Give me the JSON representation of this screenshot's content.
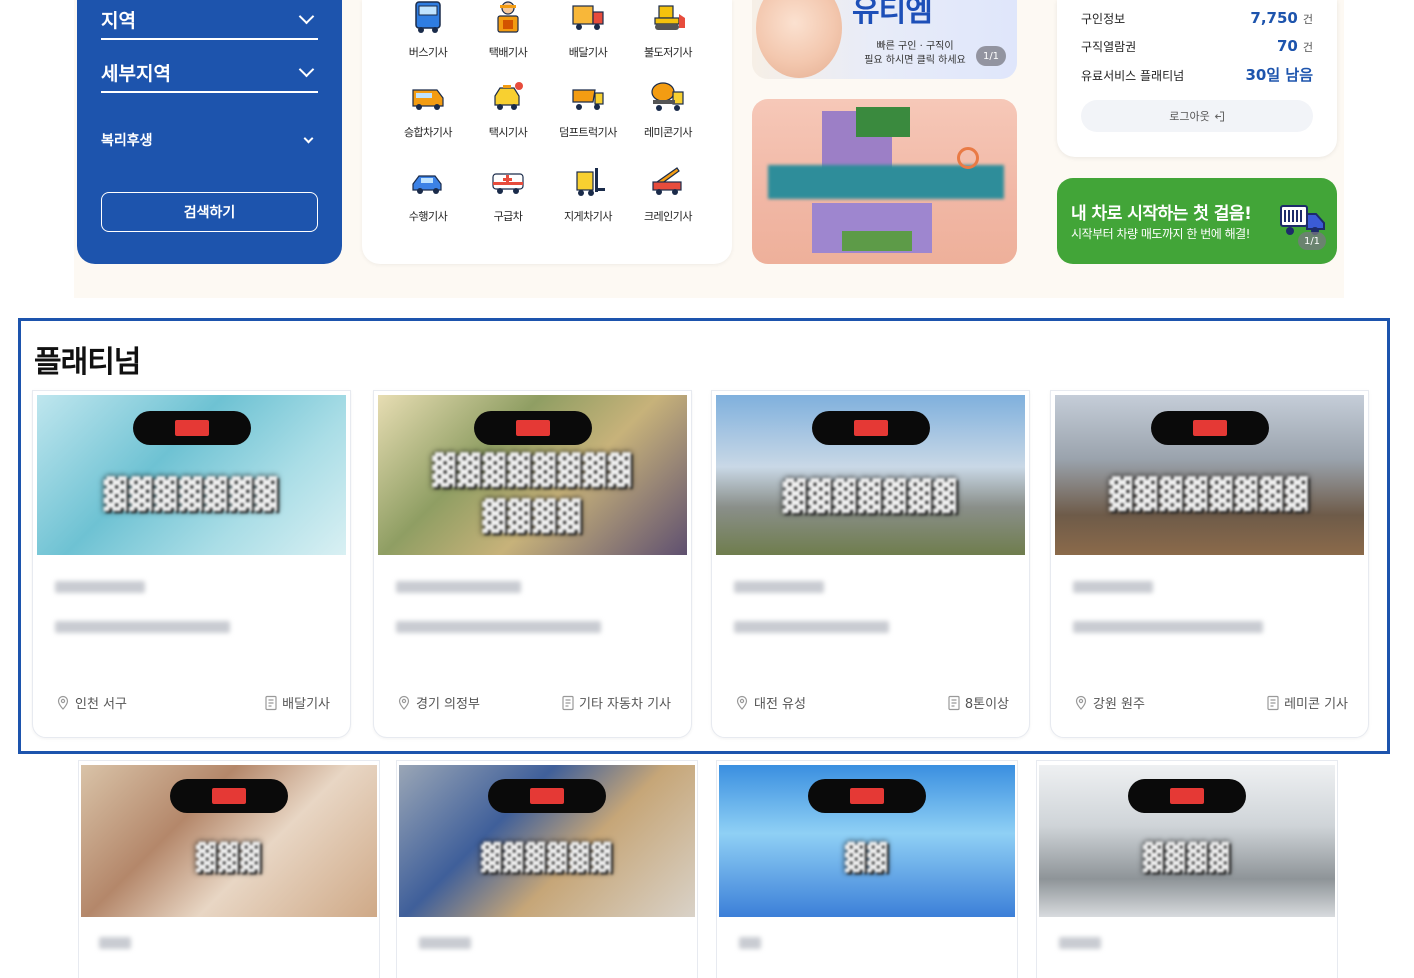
{
  "search_panel": {
    "region_label": "지역",
    "subregion_label": "세부지역",
    "welfare_label": "복리후생",
    "search_button": "검색하기"
  },
  "categories": [
    {
      "label": "버스기사",
      "icon": "bus-icon"
    },
    {
      "label": "택배기사",
      "icon": "courier-icon"
    },
    {
      "label": "배달기사",
      "icon": "delivery-truck-icon"
    },
    {
      "label": "불도저기사",
      "icon": "bulldozer-icon"
    },
    {
      "label": "승합차기사",
      "icon": "van-icon"
    },
    {
      "label": "택시기사",
      "icon": "taxi-icon"
    },
    {
      "label": "덤프트럭기사",
      "icon": "dump-truck-icon"
    },
    {
      "label": "레미콘기사",
      "icon": "concrete-mixer-icon"
    },
    {
      "label": "수행기사",
      "icon": "car-icon"
    },
    {
      "label": "구급차",
      "icon": "ambulance-icon"
    },
    {
      "label": "지게차기사",
      "icon": "forklift-icon"
    },
    {
      "label": "크레인기사",
      "icon": "crane-icon"
    }
  ],
  "banner_top": {
    "title": "유티엠",
    "text_line1": "빠른 구인 · 구직이",
    "text_line2": "필요 하시면 클릭 하세요",
    "pager": "1/1"
  },
  "info_card": {
    "rows": [
      {
        "label": "구인정보",
        "value": "7,750",
        "unit": "건"
      },
      {
        "label": "구직열람권",
        "value": "70",
        "unit": "건"
      },
      {
        "label": "유료서비스 플래티넘",
        "value": "30일 남음",
        "unit": ""
      }
    ],
    "logout": "로그아웃"
  },
  "green_banner": {
    "headline": "내 차로 시작하는 첫 걸음!",
    "sub": "시작부터 차량 매도까지 한 번에 해결!",
    "pager": "1/1"
  },
  "platinum": {
    "title": "플래티넘",
    "cards": [
      {
        "location": "인천 서구",
        "job": "배달기사"
      },
      {
        "location": "경기 의정부",
        "job": "기타 자동차 기사"
      },
      {
        "location": "대전 유성",
        "job": "8톤이상"
      },
      {
        "location": "강원 원주",
        "job": "레미콘 기사"
      }
    ]
  },
  "colors": {
    "primary_blue": "#1d54ad",
    "green": "#42a538",
    "badge_red": "#e53935"
  }
}
